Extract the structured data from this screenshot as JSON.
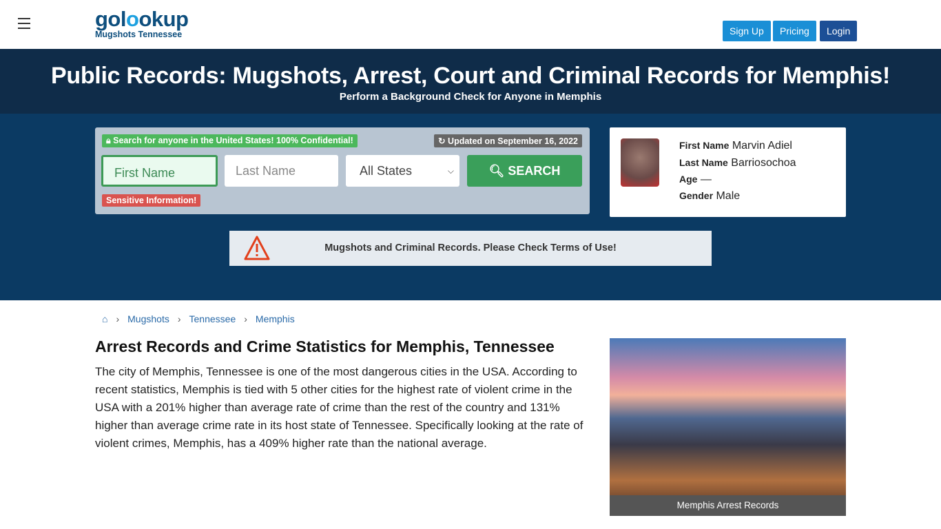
{
  "header": {
    "logo_main_a": "gol",
    "logo_main_b": "o",
    "logo_main_c": "okup",
    "logo_sub": "Mugshots Tennessee",
    "buttons": [
      {
        "label": "Sign Up",
        "color": "#1a8fd6"
      },
      {
        "label": "Pricing",
        "color": "#1a8fd6"
      },
      {
        "label": "Login",
        "color": "#1c4f96"
      }
    ]
  },
  "hero": {
    "title": "Public Records: Mugshots, Arrest, Court and Criminal Records for Memphis!",
    "subtitle": "Perform a Background Check for Anyone in Memphis"
  },
  "search": {
    "confidential_badge": "Search for anyone in the United States! 100% Confidential!",
    "updated_badge": "Updated on September 16, 2022",
    "first_name_placeholder": "First Name",
    "last_name_placeholder": "Last Name",
    "state_selected": "All States",
    "search_label": "SEARCH",
    "sensitive_badge": "Sensitive Information!"
  },
  "person": {
    "first_name_label": "First Name",
    "first_name": "Marvin Adiel",
    "last_name_label": "Last Name",
    "last_name": "Barriosochoa",
    "age_label": "Age",
    "age": "—",
    "gender_label": "Gender",
    "gender": "Male"
  },
  "notice": {
    "text": "Mugshots and Criminal Records. Please Check Terms of Use!",
    "icon": "warning-icon"
  },
  "breadcrumb": [
    {
      "label": "Mugshots"
    },
    {
      "label": "Tennessee"
    },
    {
      "label": "Memphis"
    }
  ],
  "article": {
    "heading": "Arrest Records and Crime Statistics for Memphis, Tennessee",
    "paragraph": "The city of Memphis, Tennessee is one of the most dangerous cities in the USA. According to recent statistics, Memphis is tied with 5 other cities for the highest rate of violent crime in the USA with a 201% higher than average rate of crime than the rest of the country and 131% higher than average crime rate in its host state of Tennessee. Specifically looking at the rate of violent crimes, Memphis, has a 409% higher rate than the national average.",
    "image_caption": "Memphis Arrest Records"
  }
}
